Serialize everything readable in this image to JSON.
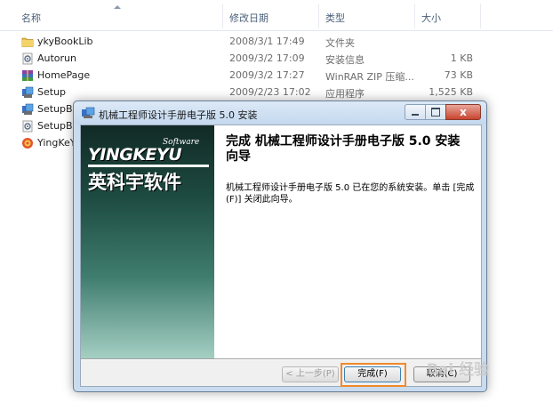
{
  "explorer": {
    "columns": {
      "name": "名称",
      "date": "修改日期",
      "type": "类型",
      "size": "大小"
    },
    "rows": [
      {
        "name": "ykyBookLib",
        "date": "2008/3/1 17:49",
        "type": "文件夹",
        "size": "",
        "icon": "folder-icon"
      },
      {
        "name": "Autorun",
        "date": "2009/3/2 17:09",
        "type": "安装信息",
        "size": "1 KB",
        "icon": "settings-file-icon"
      },
      {
        "name": "HomePage",
        "date": "2009/3/2 17:27",
        "type": "WinRAR ZIP 压缩...",
        "size": "73 KB",
        "icon": "winrar-archive-icon"
      },
      {
        "name": "Setup",
        "date": "2009/2/23 17:02",
        "type": "应用程序",
        "size": "1,525 KB",
        "icon": "setup-exe-icon"
      },
      {
        "name": "SetupBo",
        "date": "",
        "type": "",
        "size": "",
        "icon": "setup-exe-icon"
      },
      {
        "name": "SetupBo",
        "date": "",
        "type": "",
        "size": "",
        "icon": "settings-file-icon"
      },
      {
        "name": "YingKeY",
        "date": "",
        "type": "",
        "size": "",
        "icon": "app-icon"
      }
    ]
  },
  "installer": {
    "title": "机械工程师设计手册电子版 5.0 安装",
    "close_glyph": "x",
    "logo": {
      "software": "Software",
      "brand": "YINGKEYU",
      "cn": "英科宇软件"
    },
    "heading": "完成 机械工程师设计手册电子版 5.0 安装向导",
    "body": "机械工程师设计手册电子版 5.0 已在您的系统安装。单击 [完成(F)] 关闭此向导。",
    "buttons": {
      "back": "< 上一步(P)",
      "finish": "完成(F)",
      "cancel": "取消(C)"
    }
  },
  "watermark": "Bai 经验",
  "colors": {
    "highlight": "#f08a2b",
    "left_panel_top": "#122a26",
    "left_panel_bottom": "#a5cfc3"
  }
}
